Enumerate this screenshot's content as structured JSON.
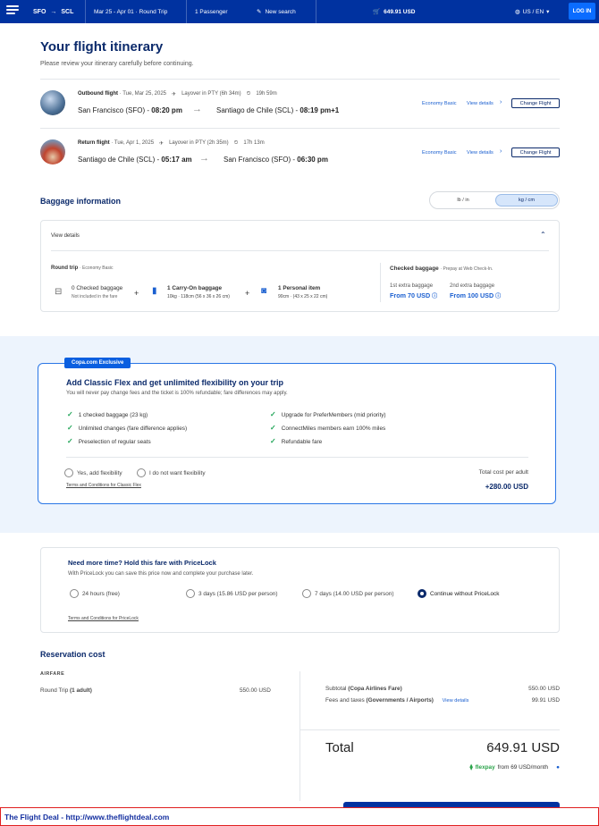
{
  "header": {
    "from": "SFO",
    "to": "SCL",
    "dates": "Mar 25 - Apr 01 · Round Trip",
    "passengers": "1 Passenger",
    "new_search": "New search",
    "price": "649.91 USD",
    "locale": "US / EN",
    "login": "LOG IN"
  },
  "page": {
    "title": "Your flight itinerary",
    "subtitle": "Please review your itinerary carefully before continuing."
  },
  "flights": [
    {
      "title": "Outbound flight",
      "date": "· Tue, Mar 25, 2025",
      "layover": "Layover in PTY (6h 34m)",
      "duration": "19h 59m",
      "from": "San Francisco (SFO) -",
      "from_time": "08:20 pm",
      "to": "Santiago de Chile (SCL) -",
      "to_time": "08:19 pm+1",
      "fare": "Economy Basic",
      "view": "View details",
      "change": "Change Flight"
    },
    {
      "title": "Return flight",
      "date": "· Tue, Apr 1, 2025",
      "layover": "Layover in PTY (2h 35m)",
      "duration": "17h 13m",
      "from": "Santiago de Chile (SCL) -",
      "from_time": "05:17 am",
      "to": "San Francisco (SFO) -",
      "to_time": "06:30 pm",
      "fare": "Economy Basic",
      "view": "View details",
      "change": "Change Flight"
    }
  ],
  "baggage": {
    "title": "Baggage information",
    "unit_lb": "lb / in",
    "unit_kg": "kg / cm",
    "view_details": "View details",
    "round_trip": "Round trip",
    "round_trip_fare": "· Economy Basic",
    "checked": "0 Checked baggage",
    "checked_note": "Not included in the fare",
    "carry": "1 Carry-On baggage",
    "carry_note": "10kg · 118cm (56 x 36 x 26 cm)",
    "personal": "1 Personal item",
    "personal_note": "90cm · (43 x 25 x 22 cm)",
    "checked_title": "Checked baggage",
    "checked_sub": "· Prepay at Web Check-In.",
    "extra1": "1st extra baggage",
    "extra1_price": "From 70 USD",
    "extra2": "2nd extra baggage",
    "extra2_price": "From 100 USD"
  },
  "flex": {
    "tag": "Copa.com Exclusive",
    "title": "Add Classic Flex and get unlimited flexibility on your trip",
    "subtitle": "You will never pay change fees and the ticket is 100% refundable; fare differences may apply.",
    "benefits_left": [
      "1 checked baggage (23 kg)",
      "Unlimited changes (fare difference applies)",
      "Preselection of regular seats"
    ],
    "benefits_right": [
      "Upgrade for PreferMembers (mid priority)",
      "ConnectMiles members earn 100% miles",
      "Refundable fare"
    ],
    "opt_yes": "Yes, add flexibility",
    "opt_no": "I do not want flexibility",
    "terms": "Terms and Conditions for Classic Flex",
    "cost_label": "Total cost per adult",
    "cost": "+280.00 USD"
  },
  "pricelock": {
    "title": "Need more time? Hold this fare with PriceLock",
    "subtitle": "With PriceLock you can save this price now and complete your purchase later.",
    "options": [
      "24 hours (free)",
      "3 days (15.86 USD per person)",
      "7 days (14.00 USD per person)",
      "Continue without PriceLock"
    ],
    "selected": 3,
    "terms": "Terms and Conditions for PriceLock"
  },
  "reservation": {
    "title": "Reservation cost",
    "airfare": "AIRFARE",
    "round_trip": "Round Trip",
    "adult": "(1 adult)",
    "airfare_amount": "550.00 USD",
    "subtotal": "Subtotal",
    "subtotal_note": "(Copa Airlines Fare)",
    "subtotal_amount": "550.00 USD",
    "fees": "Fees and taxes",
    "fees_note": "(Governments / Airports)",
    "fees_view": "View details",
    "fees_amount": "99.91 USD",
    "total": "Total",
    "total_amount": "649.91 USD",
    "flexpay": "flexpay",
    "flexpay_note": "from 69 USD/month"
  },
  "footer": {
    "text": "The Flight Deal - http://www.theflightdeal.com"
  },
  "colors": {
    "brand": "#0032a0",
    "accent": "#0a6cff",
    "heading": "#0b2a6b",
    "check": "#21a558"
  }
}
